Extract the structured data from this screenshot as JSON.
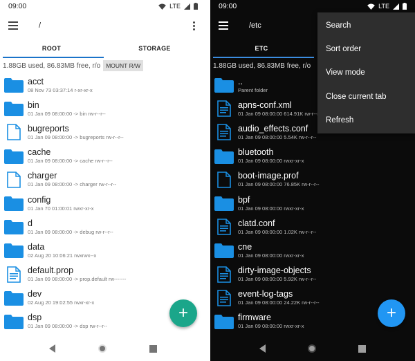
{
  "colors": {
    "folder": "#1a8fe3",
    "accent": "#1a73c9",
    "fab_left": "#1ba68a",
    "fab_right": "#2196f3"
  },
  "left": {
    "status": {
      "time": "09:00",
      "network": "LTE"
    },
    "path": "/",
    "tabs": [
      "ROOT",
      "STORAGE"
    ],
    "info": "1.88GB used, 86.83MB free, r/o",
    "mount_label": "MOUNT R/W",
    "fab": "+",
    "files": [
      {
        "name": "acct",
        "icon": "folder-icon",
        "info": "08 Nov 73 03:37:14   r-xr-xr-x"
      },
      {
        "name": "bin",
        "icon": "folder-icon",
        "info": "01 Jan 09 08:00:00   -> bin   rw-r--r--"
      },
      {
        "name": "bugreports",
        "icon": "file-icon",
        "info": "01 Jan 09 08:00:00   -> bugreports   rw-r--r--"
      },
      {
        "name": "cache",
        "icon": "folder-icon",
        "info": "01 Jan 09 08:00:00   -> cache   rw-r--r--"
      },
      {
        "name": "charger",
        "icon": "file-icon",
        "info": "01 Jan 09 08:00:00   -> charger   rw-r--r--"
      },
      {
        "name": "config",
        "icon": "folder-icon",
        "info": "01 Jan 70 01:00:01   rwxr-xr-x"
      },
      {
        "name": "d",
        "icon": "folder-icon",
        "info": "01 Jan 09 08:00:00   -> debug   rw-r--r--"
      },
      {
        "name": "data",
        "icon": "folder-icon",
        "info": "02 Aug 20 10:06:21   rwxrwx--x"
      },
      {
        "name": "default.prop",
        "icon": "text-file-icon",
        "info": "01 Jan 09 08:00:00   -> prop.default   rw-------"
      },
      {
        "name": "dev",
        "icon": "folder-icon",
        "info": "02 Aug 20 19:02:55   rwxr-xr-x"
      },
      {
        "name": "dsp",
        "icon": "folder-icon",
        "info": "01 Jan 09 08:00:00   -> dsp   rw-r--r--"
      }
    ]
  },
  "right": {
    "status": {
      "time": "09:00",
      "network": "LTE"
    },
    "path": "/etc",
    "tabs": [
      "ETC",
      ""
    ],
    "info": "1.88GB used, 86.83MB free, r/o",
    "fab": "+",
    "menu": [
      "Search",
      "Sort order",
      "View mode",
      "Close current tab",
      "Refresh"
    ],
    "files": [
      {
        "name": "..",
        "icon": "folder-icon",
        "info": "Parent folder"
      },
      {
        "name": "apns-conf.xml",
        "icon": "text-file-icon",
        "info": "01 Jan 09 08:00:00   614.91K   rw-r--r--"
      },
      {
        "name": "audio_effects.conf",
        "icon": "text-file-icon",
        "info": "01 Jan 09 08:00:00   5.54K   rw-r--r--"
      },
      {
        "name": "bluetooth",
        "icon": "folder-icon",
        "info": "01 Jan 09 08:00:00   rwxr-xr-x"
      },
      {
        "name": "boot-image.prof",
        "icon": "file-icon",
        "info": "01 Jan 09 08:00:00   76.85K   rw-r--r--"
      },
      {
        "name": "bpf",
        "icon": "folder-icon",
        "info": "01 Jan 09 08:00:00   rwxr-xr-x"
      },
      {
        "name": "clatd.conf",
        "icon": "text-file-icon",
        "info": "01 Jan 09 08:00:00   1.02K   rw-r--r--"
      },
      {
        "name": "cne",
        "icon": "folder-icon",
        "info": "01 Jan 09 08:00:00   rwxr-xr-x"
      },
      {
        "name": "dirty-image-objects",
        "icon": "text-file-icon",
        "info": "01 Jan 09 08:00:00   5.92K   rw-r--r--"
      },
      {
        "name": "event-log-tags",
        "icon": "text-file-icon",
        "info": "01 Jan 09 08:00:00   24.22K   rw-r--r--"
      },
      {
        "name": "firmware",
        "icon": "folder-icon",
        "info": "01 Jan 09 08:00:00   rwxr-xr-x"
      }
    ]
  }
}
